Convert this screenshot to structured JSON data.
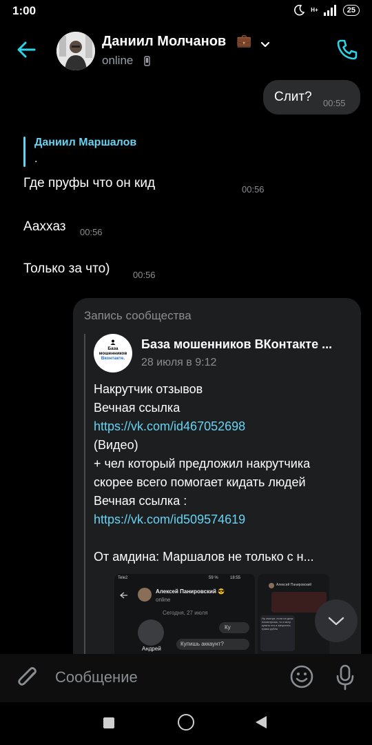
{
  "status_bar": {
    "time": "1:00",
    "network": "H+",
    "battery": "25"
  },
  "header": {
    "name": "Даниил Молчанов",
    "name_emoji": "💼",
    "status": "online",
    "icons": [
      "back-arrow-icon",
      "chevron-down-icon",
      "mobile-phone-icon",
      "call-icon"
    ],
    "accent": "#2fd3e8"
  },
  "messages": {
    "outgoing": {
      "text": "Слит?",
      "time": "00:55"
    },
    "reply": {
      "author": "Даниил Маршалов",
      "quote": "."
    },
    "incoming": [
      {
        "text": "Где пруфы что он кид",
        "time": "00:56"
      },
      {
        "text": "Аахxаз",
        "time": "00:56"
      },
      {
        "text": "Только за что)",
        "time": "00:56"
      }
    ]
  },
  "repost": {
    "header": "Запись сообщества",
    "group_name": "База мошенников ВКонтакте ...",
    "group_avatar_text": [
      "База",
      "мошенников",
      "Вконтакте."
    ],
    "date": "28 июля в 9:12",
    "lines": [
      {
        "text": "Накрутчик отзывов"
      },
      {
        "text": "Вечная ссылка"
      },
      {
        "text": "https://vk.com/id467052698"
      },
      {
        "text": "(Видео)"
      },
      {
        "text": "+ чел который предложил накрутчика"
      },
      {
        "text": "скорее всего помогает кидать людей"
      },
      {
        "text": "Вечная ссылка :"
      },
      {
        "text": "https://vk.com/id509574619"
      },
      {
        "text": ""
      },
      {
        "text": "От амдина: Маршалов не только с н..."
      }
    ],
    "link_color": "#67d3f3",
    "screenshot1": {
      "name": "Алексей Панировский 😎",
      "status": "online",
      "date": "Сегодня, 27 июля",
      "sender": "Андрей",
      "msg1": "Ку",
      "msg2": "Купишь аккаунт?",
      "carrier": "Tele2",
      "clock": "18:55",
      "battery": "59 %"
    },
    "screenshot2": {
      "name": "Алексей Панировский",
      "text": "Ну смотри, если на днях посмотришь, то я могу купить его и запустить грамо рубля"
    }
  },
  "input": {
    "placeholder": "Сообщение",
    "icons": [
      "attach-icon",
      "emoji-icon",
      "microphone-icon"
    ]
  },
  "navigation": {
    "icons": [
      "recents-square-icon",
      "home-circle-icon",
      "back-triangle-icon"
    ]
  }
}
